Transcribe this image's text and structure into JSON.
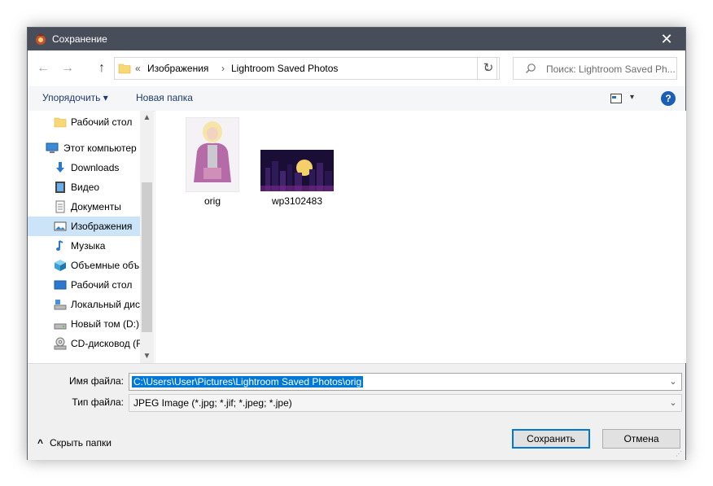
{
  "window": {
    "title": "Сохранение",
    "close_label": "✕"
  },
  "navbar": {
    "back": "←",
    "forward": "→",
    "up": "↑",
    "chevron": "«",
    "path": [
      "Изображения",
      "Lightroom Saved Photos"
    ],
    "path_sep": "›",
    "dropdown": "⌄",
    "refresh": "↻",
    "search_placeholder": "Поиск: Lightroom Saved Ph..."
  },
  "toolbar": {
    "organize_label": "Упорядочить ▾",
    "new_folder_label": "Новая папка",
    "view_label": "▾",
    "help_label": "?"
  },
  "sidebar": {
    "items": [
      {
        "label": "Рабочий стол",
        "icon": "folder-icon"
      },
      {
        "label": "Этот компьютер",
        "icon": "computer-icon"
      },
      {
        "label": "Downloads",
        "icon": "download-icon"
      },
      {
        "label": "Видео",
        "icon": "video-icon"
      },
      {
        "label": "Документы",
        "icon": "document-icon"
      },
      {
        "label": "Изображения",
        "icon": "pictures-icon"
      },
      {
        "label": "Музыка",
        "icon": "music-icon"
      },
      {
        "label": "Объемные объ",
        "icon": "3d-objects-icon"
      },
      {
        "label": "Рабочий стол",
        "icon": "desktop-icon"
      },
      {
        "label": "Локальный дис",
        "icon": "local-disk-icon"
      },
      {
        "label": "Новый том (D:)",
        "icon": "drive-icon"
      },
      {
        "label": "CD-дисковод (F:",
        "icon": "cd-drive-icon"
      }
    ],
    "selected": "Изображения",
    "scroll_up": "▲",
    "scroll_down": "▼"
  },
  "files": [
    {
      "name": "orig",
      "thumb": "portrait-thumbnail"
    },
    {
      "name": "wp3102483",
      "thumb": "city-night-thumbnail"
    }
  ],
  "form": {
    "filename_label": "Имя файла:",
    "filename_value": "C:\\Users\\User\\Pictures\\Lightroom Saved Photos\\orig",
    "filetype_label": "Тип файла:",
    "filetype_value": "JPEG Image (*.jpg; *.jif; *.jpeg; *.jpe)",
    "dropdown": "⌄"
  },
  "footer": {
    "hide_folders_label": "Скрыть папки",
    "hide_icon": "^",
    "save_label": "Сохранить",
    "cancel_label": "Отмена"
  },
  "colors": {
    "titlebar": "#474d59",
    "selection": "#cce4f7",
    "accent": "#0078d7"
  }
}
